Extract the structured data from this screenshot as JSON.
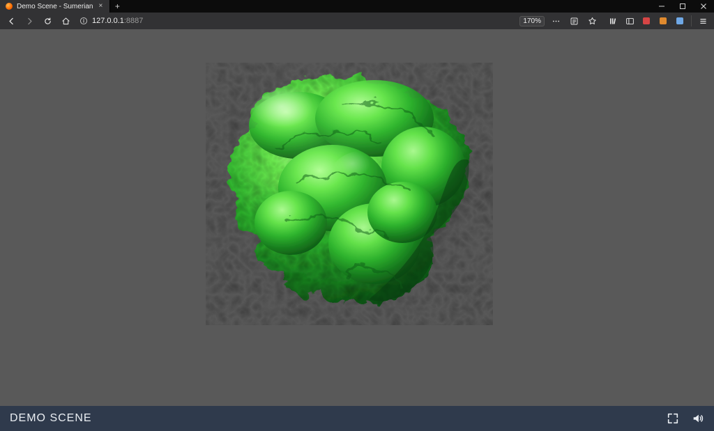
{
  "window": {
    "min_icon": "window-minimize-icon",
    "max_icon": "window-maximize-icon",
    "close_icon": "window-close-icon"
  },
  "tab": {
    "title": "Demo Scene - Sumerian",
    "favicon": "sumerian-favicon",
    "close_icon": "tab-close-icon",
    "new_tab_icon": "new-tab-icon",
    "new_tab_glyph": "+"
  },
  "toolbar": {
    "back_icon": "back-icon",
    "forward_icon": "forward-icon",
    "reload_icon": "reload-icon",
    "home_icon": "home-icon",
    "info_icon": "site-info-icon",
    "url_host": "127.0.0.1",
    "url_rest": ":8887",
    "zoom_label": "170%",
    "page_actions_icon": "page-actions-icon",
    "reader_icon": "reader-view-icon",
    "bookmark_icon": "bookmark-star-icon",
    "library_icon": "library-icon",
    "sidebar_icon": "sidebar-icon",
    "ext_red_icon": "extension-red-icon",
    "ext_orange_icon": "extension-orange-icon",
    "ext_blue_icon": "extension-blue-icon",
    "menu_icon": "hamburger-menu-icon"
  },
  "viewport": {
    "model_name": "demo-brain-mesh",
    "model_color": "#3fdc3f",
    "background": "#595959",
    "shadow_name": "floor-shadow"
  },
  "bottombar": {
    "title": "DEMO SCENE",
    "fullscreen_icon": "fullscreen-icon",
    "volume_icon": "volume-icon"
  }
}
